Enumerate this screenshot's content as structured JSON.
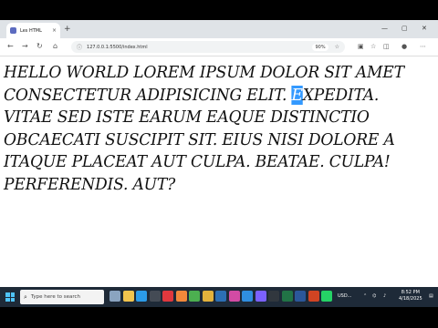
{
  "browser": {
    "tab_title": "Les HTML",
    "tab_close": "×",
    "new_tab": "+",
    "url": "127.0.0.1:5500/index.html",
    "zoom": "90%",
    "window_controls": [
      "—",
      "▢",
      "✕"
    ]
  },
  "content": {
    "before_selection": "HELLO WORLD LOREM IPSUM DOLOR SIT AMET CONSECTETUR ADIPISICING ELIT. ",
    "selected": "E",
    "after_selection": "XPEDITA. VITAE SED ISTE EARUM EAQUE DISTINCTIO OBCAECATI SUSCIPIT SIT. EIUS NISI DOLORE A ITAQUE PLACEAT AUT CULPA. BEATAE. CULPA! PERFERENDIS. AUT?"
  },
  "taskbar": {
    "search_placeholder": "Type here to search",
    "tray_currency": "USD...",
    "clock_time": "8:52 PM",
    "clock_date": "4/18/2025",
    "apps": [
      {
        "name": "task-view",
        "color": "#8aa4c0"
      },
      {
        "name": "file-explorer",
        "color": "#f2c44d"
      },
      {
        "name": "edge",
        "color": "#2b9be8"
      },
      {
        "name": "terminal",
        "color": "#444b55"
      },
      {
        "name": "opera",
        "color": "#e0383e"
      },
      {
        "name": "firefox",
        "color": "#f2883a"
      },
      {
        "name": "chrome",
        "color": "#4caf50"
      },
      {
        "name": "paint",
        "color": "#e3b23c"
      },
      {
        "name": "photoshop",
        "color": "#2c6fb5"
      },
      {
        "name": "xd",
        "color": "#d24ba4"
      },
      {
        "name": "vscode",
        "color": "#2f8ee0"
      },
      {
        "name": "figma",
        "color": "#7b61ff"
      },
      {
        "name": "app-dark",
        "color": "#31373e"
      },
      {
        "name": "excel",
        "color": "#217346"
      },
      {
        "name": "word",
        "color": "#2b579a"
      },
      {
        "name": "powerpoint",
        "color": "#d04423"
      },
      {
        "name": "whatsapp",
        "color": "#25d366"
      }
    ]
  }
}
